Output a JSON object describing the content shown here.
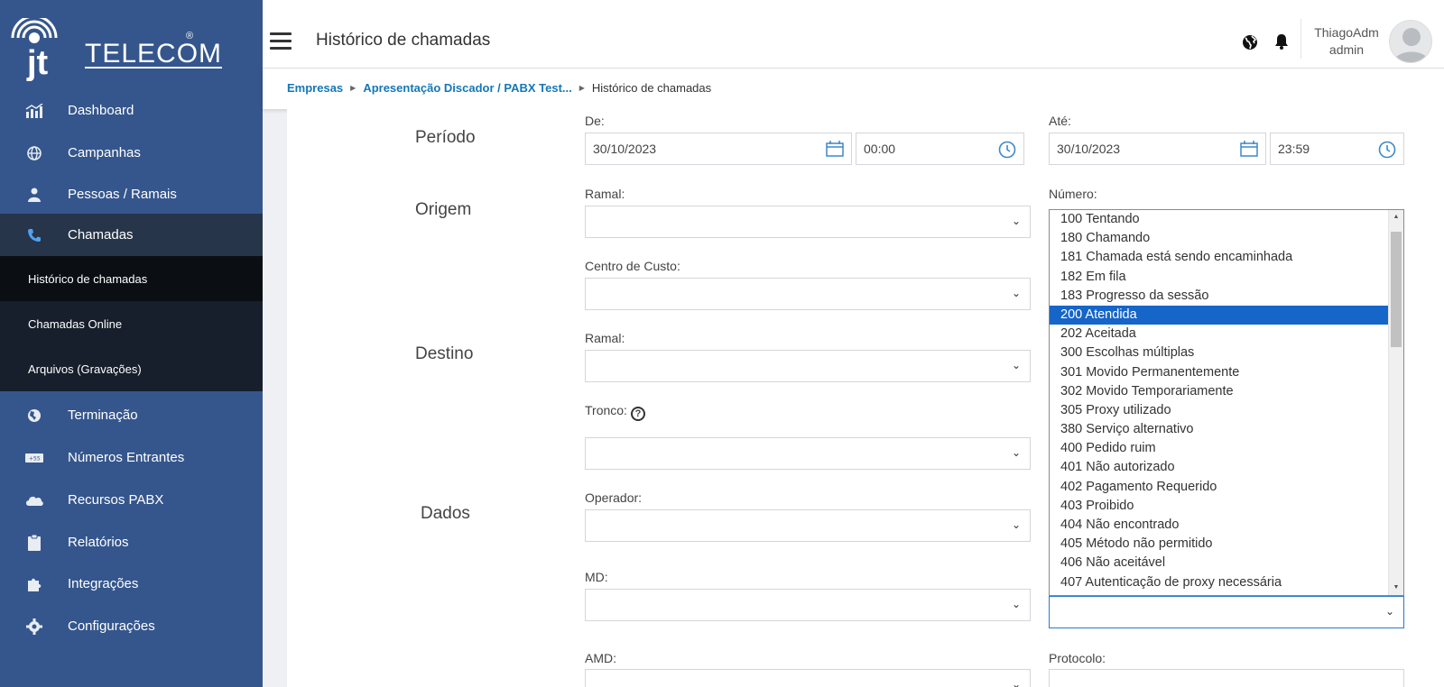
{
  "brand": {
    "name": "TELECOM",
    "mark": "jt",
    "reg": "®"
  },
  "sidebar": {
    "items": [
      {
        "label": "Dashboard",
        "icon": "chart-bars-icon"
      },
      {
        "label": "Campanhas",
        "icon": "globe-icon"
      },
      {
        "label": "Pessoas / Ramais",
        "icon": "user-icon"
      },
      {
        "label": "Chamadas",
        "icon": "phone-icon"
      },
      {
        "label": "Terminação",
        "icon": "globe-africa-icon"
      },
      {
        "label": "Números Entrantes",
        "icon": "number-tag-icon"
      },
      {
        "label": "Recursos PABX",
        "icon": "cloud-icon"
      },
      {
        "label": "Relatórios",
        "icon": "clipboard-icon"
      },
      {
        "label": "Integrações",
        "icon": "puzzle-icon"
      },
      {
        "label": "Configurações",
        "icon": "gear-icon"
      }
    ],
    "subitems": [
      {
        "label": "Histórico de chamadas"
      },
      {
        "label": "Chamadas Online"
      },
      {
        "label": "Arquivos (Gravações)"
      }
    ]
  },
  "header": {
    "title": "Histórico de chamadas",
    "user": {
      "name": "ThiagoAdm",
      "role": "admin"
    }
  },
  "breadcrumb": {
    "items": [
      "Empresas",
      "Apresentação Discador / PABX Test...",
      "Histórico de chamadas"
    ]
  },
  "form": {
    "sections": {
      "periodo": "Período",
      "origem": "Origem",
      "destino": "Destino",
      "dados": "Dados"
    },
    "labels": {
      "de": "De:",
      "ate": "Até:",
      "ramal_origem": "Ramal:",
      "numero": "Número:",
      "centro_custo": "Centro de Custo:",
      "ramal_destino": "Ramal:",
      "tronco": "Tronco:",
      "operador": "Operador:",
      "md": "MD:",
      "amd": "AMD:",
      "protocolo": "Protocolo:"
    },
    "values": {
      "de_date": "30/10/2023",
      "de_time": "00:00",
      "ate_date": "30/10/2023",
      "ate_time": "23:59"
    },
    "help_icon": "?"
  },
  "status_dropdown": {
    "selected": "200 Atendida",
    "options": [
      "100 Tentando",
      "180 Chamando",
      "181 Chamada está sendo encaminhada",
      "182 Em fila",
      "183 Progresso da sessão",
      "200 Atendida",
      "202 Aceitada",
      "300 Escolhas múltiplas",
      "301 Movido Permanentemente",
      "302 Movido Temporariamente",
      "305 Proxy utilizado",
      "380 Serviço alternativo",
      "400 Pedido ruim",
      "401 Não autorizado",
      "402 Pagamento Requerido",
      "403 Proibido",
      "404 Não encontrado",
      "405 Método não permitido",
      "406 Não aceitável",
      "407 Autenticação de proxy necessária"
    ]
  },
  "colors": {
    "sidebar": "#35568c",
    "sidebar_active": "#27354a",
    "accent": "#1477b7",
    "selected_option": "#1665c8"
  }
}
